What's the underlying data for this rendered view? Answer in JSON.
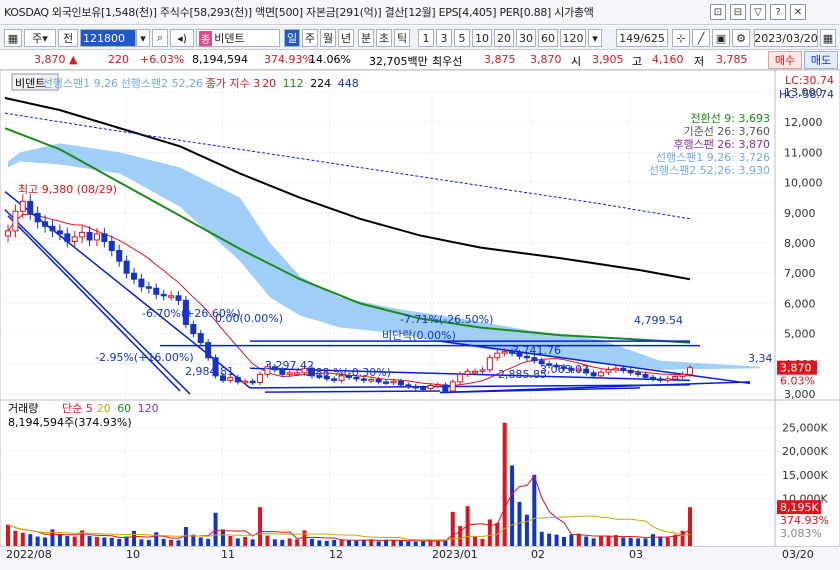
{
  "infobar": {
    "text": "KOSDAQ 외국인보유[1,548(천)] 주식수[58,293(천)] 액면[500] 자본금[291(억)] 결산[12월] EPS[4,405] PER[0.88] 시가총액",
    "window_buttons": [
      "⊡",
      "⊟",
      "▽",
      "?",
      "✕"
    ]
  },
  "toolbar": {
    "type1": "주",
    "type2": "전",
    "code": "121800",
    "stock_badge": "종",
    "stock_name": "비덴트",
    "period_buttons": [
      "일",
      "주",
      "월",
      "년",
      "분",
      "초",
      "틱"
    ],
    "interval_buttons": [
      "1",
      "3",
      "5",
      "10",
      "20",
      "30",
      "60",
      "120"
    ],
    "page": "149/625",
    "date": "2023/03/20"
  },
  "quote": {
    "price": "3,870",
    "arrow": "▲",
    "change": "220",
    "change_pct": "+6.03%",
    "volume": "8,194,594",
    "volume_ratio": "374.93%",
    "turnover": "14.06%",
    "amount": "32,705백만",
    "best_ask_label": "최우선",
    "best_ask": "3,875",
    "best_bid": "3,870",
    "open_label": "시",
    "open": "3,905",
    "high_label": "고",
    "high": "4,160",
    "low_label": "저",
    "low": "3,785",
    "buy_label": "매수",
    "sell_label": "매도"
  },
  "colors": {
    "candle_up": "#e0141e",
    "candle_down": "#1433c8",
    "cloud": "#8ec5f4",
    "ma_black": "#000000",
    "ma_green": "#1a8a1a",
    "channel": "#0a1fd6",
    "volume_up": "#e0141e",
    "volume_down": "#1433c8"
  },
  "chart_data": {
    "type": "line",
    "title": "비덴트",
    "legend": [
      {
        "name": "비덴트",
        "color": "#000000"
      },
      {
        "name": "선행스팬1 9,26",
        "color": "#74a9e8"
      },
      {
        "name": "선행스팬2 52,26",
        "color": "#74a9e8"
      },
      {
        "name": "종가 지수 3",
        "color": "#e0141e"
      },
      {
        "name": "20",
        "color": "#e0141e"
      },
      {
        "name": "112",
        "color": "#1a8a1a"
      },
      {
        "name": "224",
        "color": "#000000"
      },
      {
        "name": "448",
        "color": "#1433c8"
      }
    ],
    "corner_labels": {
      "lc": "LC:30.74",
      "hc": "HC:-58.74"
    },
    "ichimoku_labels": [
      "전환선 9: 3,693",
      "기준선 26: 3,760",
      "후행스팬 26: 3,870",
      "선행스팬1 9,26: 3,726",
      "선행스팬2 52,26: 3,930"
    ],
    "ylim": [
      2800,
      13000
    ],
    "y_ticks": [
      "13,000",
      "12,000",
      "11,000",
      "10,000",
      "9,000",
      "8,000",
      "7,000",
      "6,000",
      "5,000",
      "4,000",
      "3,000"
    ],
    "price_marker": "3,870",
    "pct_marker": "6.03%",
    "annotations": [
      "최고 9,380 (08/29)",
      "-6.70%(+26.60%)",
      "0.00(0.00%)",
      "-2.95%(+16.00%)",
      "2,984.81",
      "3,297.42",
      "1.88 %(-0.30%)",
      "-7.71%(-26.50%)",
      "비단락(0.00%)",
      "3,741.76",
      "2,885.85",
      "3,063.02",
      "4,799.54",
      "3,34"
    ],
    "x_labels": [
      "2022/08",
      "10",
      "11",
      "12",
      "2023/01",
      "02",
      "03"
    ],
    "date_label": "03/20",
    "closes": [
      8400,
      9050,
      9380,
      8980,
      8700,
      8550,
      8400,
      8300,
      8050,
      8200,
      8350,
      8100,
      8300,
      8050,
      7750,
      7400,
      7000,
      6800,
      6550,
      6500,
      6300,
      6250,
      6250,
      6100,
      5300,
      5000,
      4700,
      4200,
      3600,
      3450,
      3550,
      3400,
      3420,
      3380,
      3650,
      3900,
      3800,
      3650,
      3700,
      3700,
      3850,
      3600,
      3580,
      3500,
      3450,
      3600,
      3550,
      3500,
      3450,
      3480,
      3400,
      3380,
      3420,
      3300,
      3250,
      3200,
      3180,
      3280,
      3300,
      3100,
      3400,
      3650,
      3750,
      3750,
      3800,
      4200,
      4350,
      4400,
      4350,
      4250,
      4200,
      4100,
      4000,
      3950,
      3900,
      3850,
      3780,
      3820,
      3700,
      3600,
      3720,
      3800,
      3850,
      3780,
      3700,
      3650,
      3550,
      3500,
      3460,
      3500,
      3580,
      3650,
      3870
    ],
    "volume": {
      "title": "거래량",
      "ma_legend": [
        "단순 5",
        "20",
        "60",
        "120"
      ],
      "summary": "8,194,594주(374.93%)",
      "ylim": [
        0,
        27000000
      ],
      "y_ticks": [
        "25,000K",
        "20,000K",
        "15,000K",
        "10,000K"
      ],
      "last_value": "8,195K",
      "last_pct": "374.93%",
      "prev_value": "3,083%",
      "values": [
        4500,
        3200,
        2800,
        2500,
        2000,
        1800,
        3500,
        2400,
        2100,
        2000,
        3300,
        2100,
        1900,
        1800,
        1700,
        1500,
        2000,
        3200,
        1400,
        1300,
        2900,
        1500,
        1300,
        1200,
        4000,
        2400,
        1800,
        1500,
        7000,
        3500,
        2100,
        1600,
        1900,
        1400,
        8200,
        2200,
        1400,
        1300,
        1600,
        1400,
        3300,
        1500,
        1200,
        1100,
        1300,
        1400,
        1200,
        1100,
        1200,
        1400,
        1000,
        1300,
        1200,
        1100,
        1000,
        900,
        1100,
        1300,
        1000,
        1200,
        7200,
        4200,
        8400,
        2100,
        1500,
        5600,
        4900,
        26000,
        17000,
        9300,
        6600,
        15000,
        3000,
        2600,
        2400,
        1900,
        2400,
        2600,
        2000,
        1600,
        2000,
        2200,
        2300,
        1800,
        1700,
        1600,
        1600,
        2500,
        2000,
        1800,
        2400,
        3200,
        8195
      ]
    }
  }
}
